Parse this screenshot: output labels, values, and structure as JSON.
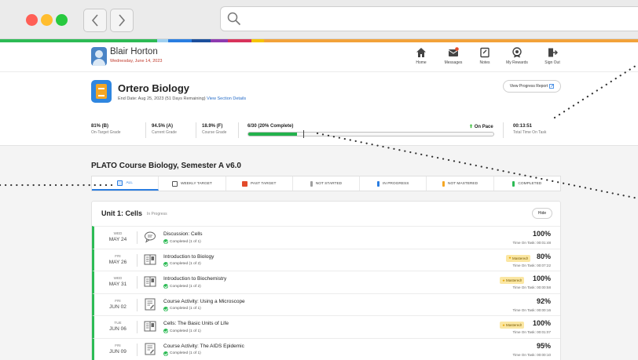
{
  "user": {
    "name": "Blair Horton",
    "date": "Wednesday, June 14, 2023"
  },
  "topnav": [
    {
      "label": "Home",
      "icon": "home-icon"
    },
    {
      "label": "Messages",
      "icon": "messages-icon"
    },
    {
      "label": "Notes",
      "icon": "notes-icon"
    },
    {
      "label": "My Rewards",
      "icon": "rewards-icon"
    },
    {
      "label": "Sign Out",
      "icon": "sign-out-icon"
    }
  ],
  "course": {
    "title": "Ortero Biology",
    "end_date": "End Date: Aug 25, 2023 (51 Days Remaining)",
    "details_link": "View Section Details",
    "report_button": "View Progress Report"
  },
  "stats": [
    {
      "value": "81% (B)",
      "label": "On-Target Grade"
    },
    {
      "value": "94.5% (A)",
      "label": "Current Grade"
    },
    {
      "value": "18.9% (F)",
      "label": "Course Grade"
    }
  ],
  "progress": {
    "text": "6/30 (20% Complete)",
    "fraction": 0.2,
    "status": "On Pace"
  },
  "time_on_task": {
    "value": "00:13:51",
    "label": "Total Time On Task"
  },
  "section_title": "PLATO Course Biology, Semester A v6.0",
  "filters": [
    {
      "label": "ALL",
      "color": "#2a7de1"
    },
    {
      "label": "WEEKLY TARGET",
      "color": "#555555"
    },
    {
      "label": "PAST TARGET",
      "color": "#e24b2b"
    },
    {
      "label": "NOT STARTED",
      "color": "#9e9e9e"
    },
    {
      "label": "IN PROGRESS",
      "color": "#2a7de1"
    },
    {
      "label": "NOT MASTERED",
      "color": "#f5a623"
    },
    {
      "label": "COMPLETED",
      "color": "#2dbb55"
    }
  ],
  "unit": {
    "title": "Unit 1: Cells",
    "status": "In Progress",
    "hide_label": "Hide",
    "mastered_label": "Mastered!",
    "rows": [
      {
        "day": "WED",
        "date": "MAY 24",
        "title": "Discussion: Cells",
        "completed": "Completed (1 of 1)",
        "percent": "100%",
        "time": "Time On Task: 00:01:48",
        "mastered": false,
        "icon": "discussion-icon"
      },
      {
        "day": "FRI",
        "date": "MAY 26",
        "title": "Introduction to Biology",
        "completed": "Completed (1 of 2)",
        "percent": "80%",
        "time": "Time On Task: 00:07:22",
        "mastered": true,
        "icon": "lesson-icon"
      },
      {
        "day": "WED",
        "date": "MAY 31",
        "title": "Introduction to Biochemistry",
        "completed": "Completed (1 of 2)",
        "percent": "100%",
        "time": "Time On Task: 00:00:58",
        "mastered": true,
        "icon": "lesson-icon"
      },
      {
        "day": "FRI",
        "date": "JUN 02",
        "title": "Course Activity: Using a Microscope",
        "completed": "Completed (1 of 1)",
        "percent": "92%",
        "time": "Time On Task: 00:00:16",
        "mastered": false,
        "icon": "activity-icon"
      },
      {
        "day": "TUE",
        "date": "JUN 06",
        "title": "Cells: The Basic Units of Life",
        "completed": "Completed (1 of 1)",
        "percent": "100%",
        "time": "Time On Task: 00:01:07",
        "mastered": true,
        "icon": "lesson-icon"
      },
      {
        "day": "FRI",
        "date": "JUN 09",
        "title": "Course Activity: The AIDS Epidemic",
        "completed": "Completed (1 of 1)",
        "percent": "95%",
        "time": "Time On Task: 00:00:10",
        "mastered": false,
        "icon": "activity-icon"
      }
    ]
  }
}
